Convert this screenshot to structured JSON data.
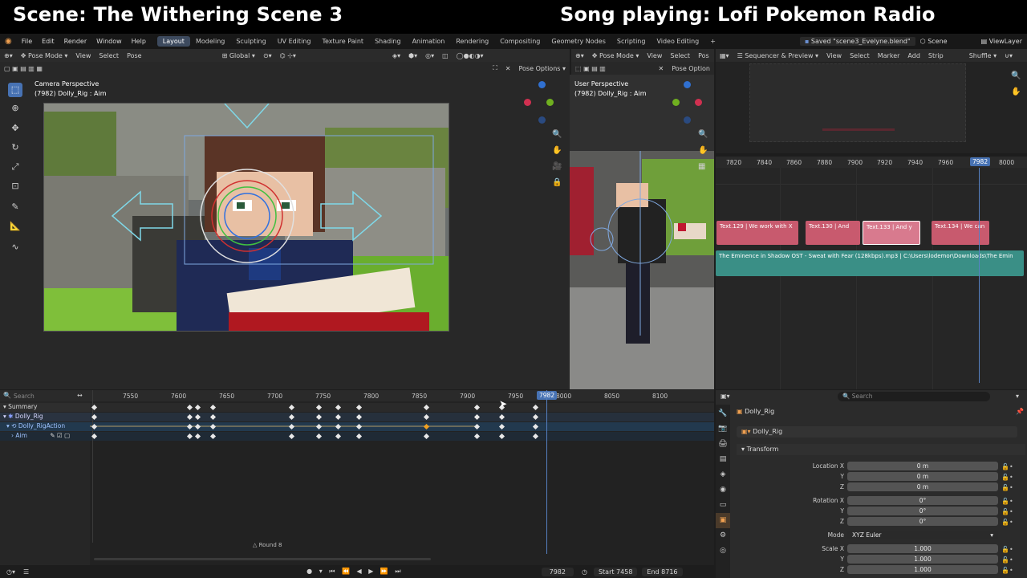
{
  "banner": {
    "left": "Scene: The Withering Scene 3",
    "right": "Song playing: Lofi Pokemon Radio"
  },
  "menu": {
    "items": [
      "File",
      "Edit",
      "Render",
      "Window",
      "Help"
    ],
    "workspaces": [
      "Layout",
      "Modeling",
      "Sculpting",
      "UV Editing",
      "Texture Paint",
      "Shading",
      "Animation",
      "Rendering",
      "Compositing",
      "Geometry Nodes",
      "Scripting",
      "Video Editing"
    ],
    "active_workspace": "Layout",
    "saved_status": "Saved \"scene3_Evelyne.blend\"",
    "scene": "Scene",
    "view_layer": "ViewLayer"
  },
  "viewport_left": {
    "mode": "Pose Mode",
    "menus": [
      "View",
      "Select",
      "Pose"
    ],
    "orientation": "Global",
    "pose_options": "Pose Options",
    "title": "Camera Perspective",
    "subtitle": "(7982) Dolly_Rig : Aim"
  },
  "viewport_right": {
    "mode": "Pose Mode",
    "menus": [
      "View",
      "Select",
      "Pos"
    ],
    "pose_options": "Pose Option",
    "title": "User Perspective",
    "subtitle": "(7982) Dolly_Rig : Aim"
  },
  "sequencer": {
    "mode": "Sequencer & Preview",
    "menus": [
      "View",
      "Select",
      "Marker",
      "Add",
      "Strip"
    ],
    "shuffle": "Shuffle",
    "ruler": [
      "7820",
      "7840",
      "7860",
      "7880",
      "7900",
      "7920",
      "7940",
      "7960",
      "8000"
    ],
    "current_frame": "7982",
    "strips": [
      {
        "label": "Text.129 | We work with X",
        "color": "#c85a6e"
      },
      {
        "label": "Text.130 | And",
        "color": "#c85a6e"
      },
      {
        "label": "Text.133 | And y",
        "color": "#d87a8e"
      },
      {
        "label": "Text.134 | We can",
        "color": "#c85a6e"
      }
    ],
    "audio_strip": "The Eminence in Shadow OST - Sweat with Fear (128kbps).mp3 | C:\\Users\\lodemor\\Downloads\\The Emin"
  },
  "dopesheet": {
    "search_placeholder": "Search",
    "ruler": [
      "7550",
      "7600",
      "7650",
      "7700",
      "7750",
      "7800",
      "7850",
      "7900",
      "7950",
      "8000",
      "8050",
      "8100"
    ],
    "current_frame": "7982",
    "channels": [
      "Summary",
      "Dolly_Rig",
      "Dolly_RigAction",
      "Aim"
    ],
    "footer_label": "Round 8"
  },
  "playback": {
    "frame": "7982",
    "start_label": "Start",
    "start": "7458",
    "end_label": "End",
    "end": "8716"
  },
  "properties": {
    "search_placeholder": "Search",
    "object": "Dolly_Rig",
    "data": "Dolly_Rig",
    "panel": "Transform",
    "location_label": "Location X",
    "location": [
      "0 m",
      "0 m",
      "0 m"
    ],
    "rotation_label": "Rotation X",
    "rotation": [
      "0°",
      "0°",
      "0°"
    ],
    "mode_label": "Mode",
    "mode": "XYZ Euler",
    "scale_label": "Scale X",
    "scale": [
      "1.000",
      "1.000",
      "1.000"
    ],
    "y": "Y",
    "z": "Z"
  },
  "colors": {
    "accent": "#4772b3",
    "playhead": "#5680c2",
    "audio": "#3a8f86",
    "text_strip": "#c85a6e"
  }
}
